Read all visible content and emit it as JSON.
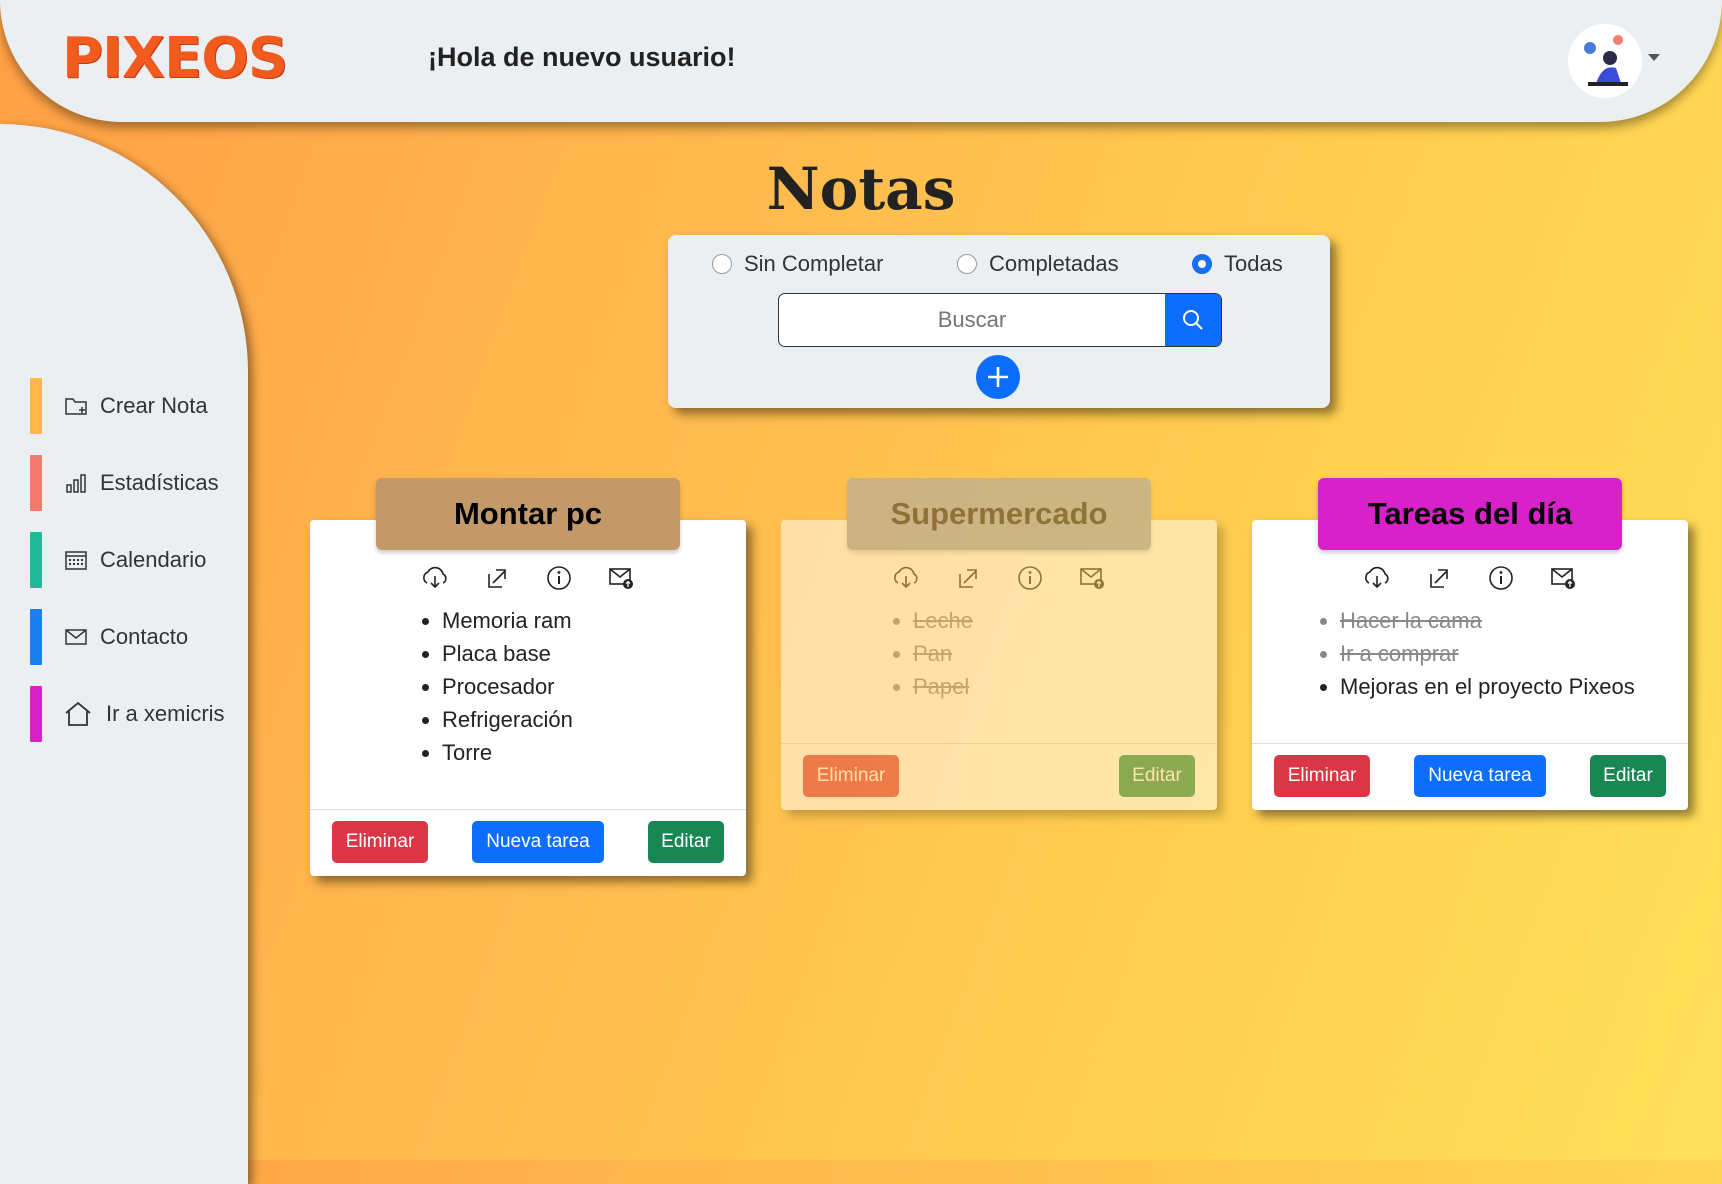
{
  "header": {
    "logo": "PIXEOS",
    "greeting": "¡Hola de nuevo usuario!"
  },
  "sidebar": {
    "items": [
      {
        "label": "Crear Nota",
        "color": "#ffb649",
        "icon": "folder-plus-icon"
      },
      {
        "label": "Estadísticas",
        "color": "#f27a6c",
        "icon": "bar-chart-icon"
      },
      {
        "label": "Calendario",
        "color": "#22b99a",
        "icon": "calendar-icon"
      },
      {
        "label": "Contacto",
        "color": "#1a7ff0",
        "icon": "envelope-icon"
      },
      {
        "label": "Ir a xemicris",
        "color": "#d622c8",
        "icon": "home-icon"
      }
    ]
  },
  "main": {
    "title": "Notas",
    "filters": {
      "options": [
        "Sin Completar",
        "Completadas",
        "Todas"
      ],
      "selected": "Todas"
    },
    "search": {
      "placeholder": "Buscar"
    }
  },
  "notes": [
    {
      "title": "Montar pc",
      "title_color": "#c4996a",
      "completed": false,
      "tasks": [
        {
          "text": "Memoria ram",
          "done": false
        },
        {
          "text": "Placa base",
          "done": false
        },
        {
          "text": "Procesador",
          "done": false
        },
        {
          "text": "Refrigeración",
          "done": false
        },
        {
          "text": "Torre",
          "done": false
        }
      ],
      "buttons": {
        "delete": "Eliminar",
        "new_task": "Nueva tarea",
        "edit": "Editar"
      }
    },
    {
      "title": "Supermercado",
      "title_color": "#9aa4b8",
      "completed": true,
      "tasks": [
        {
          "text": "Leche",
          "done": true
        },
        {
          "text": "Pan",
          "done": true
        },
        {
          "text": "Papel",
          "done": true
        }
      ],
      "buttons": {
        "delete": "Eliminar",
        "edit": "Editar"
      }
    },
    {
      "title": "Tareas del día",
      "title_color": "#d622c8",
      "completed": false,
      "tasks": [
        {
          "text": "Hacer la cama",
          "done": true
        },
        {
          "text": "Ir a comprar",
          "done": true
        },
        {
          "text": "Mejoras en el proyecto Pixeos",
          "done": false
        }
      ],
      "buttons": {
        "delete": "Eliminar",
        "new_task": "Nueva tarea",
        "edit": "Editar"
      }
    }
  ]
}
